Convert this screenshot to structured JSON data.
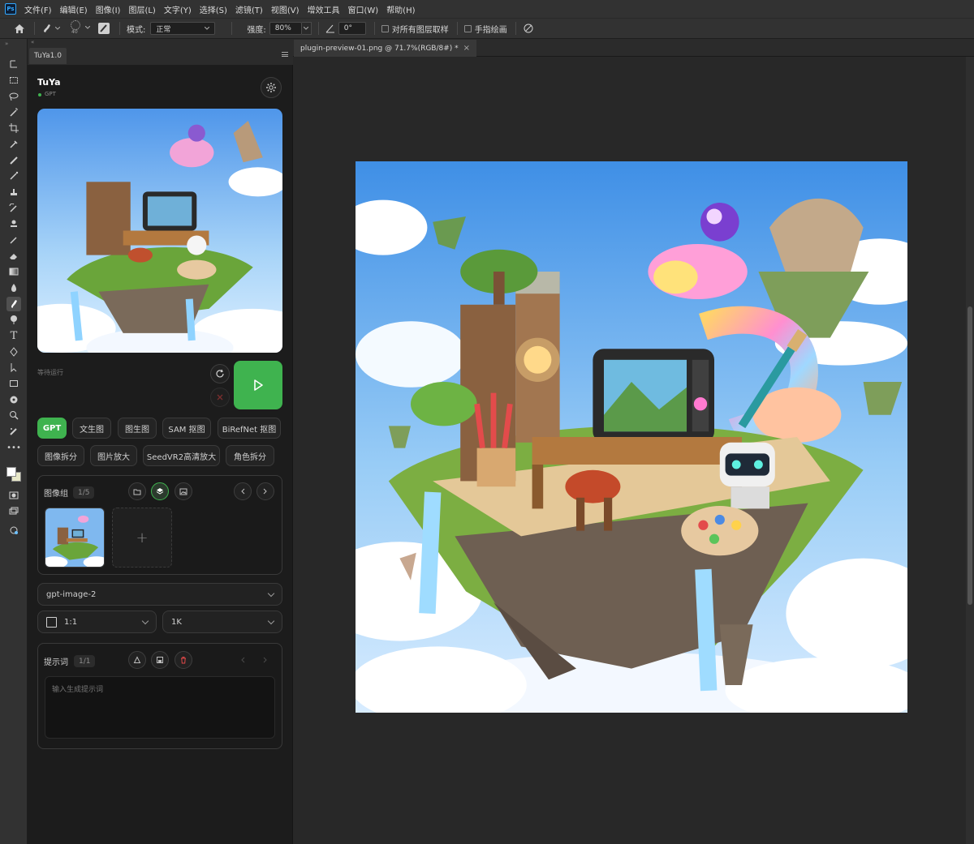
{
  "menu": {
    "logo": "Ps",
    "items": [
      "文件(F)",
      "编辑(E)",
      "图像(I)",
      "图层(L)",
      "文字(Y)",
      "选择(S)",
      "滤镜(T)",
      "视图(V)",
      "增效工具",
      "窗口(W)",
      "帮助(H)"
    ]
  },
  "options": {
    "brush_size": "40",
    "mode_label": "模式:",
    "mode_value": "正常",
    "strength_label": "强度:",
    "strength_value": "80%",
    "angle_value": "0°",
    "sample_all_label": "对所有图层取样",
    "finger_paint_label": "手指绘画"
  },
  "panel": {
    "tab": "TuYa1.0",
    "title": "TuYa",
    "subtitle": "GPT",
    "status_color": "#3fb34f",
    "status_text": "等待运行",
    "run_button_color": "#3fb34f",
    "modes_row1": [
      "GPT",
      "文生图",
      "图生图",
      "SAM 抠图",
      "BiRefNet 抠图"
    ],
    "modes_row2": [
      "图像拆分",
      "图片放大",
      "SeedVR2高清放大",
      "角色拆分"
    ],
    "active_mode": "GPT",
    "image_group": {
      "label": "图像组",
      "count": "1/5",
      "add_symbol": "+"
    },
    "model": "gpt-image-2",
    "ratio": "1:1",
    "resolution": "1K",
    "prompt": {
      "label": "提示词",
      "count": "1/1",
      "placeholder": "输入生成提示词"
    }
  },
  "document": {
    "tab": "plugin-preview-01.png @ 71.7%(RGB/8#) *",
    "close_symbol": "×"
  }
}
